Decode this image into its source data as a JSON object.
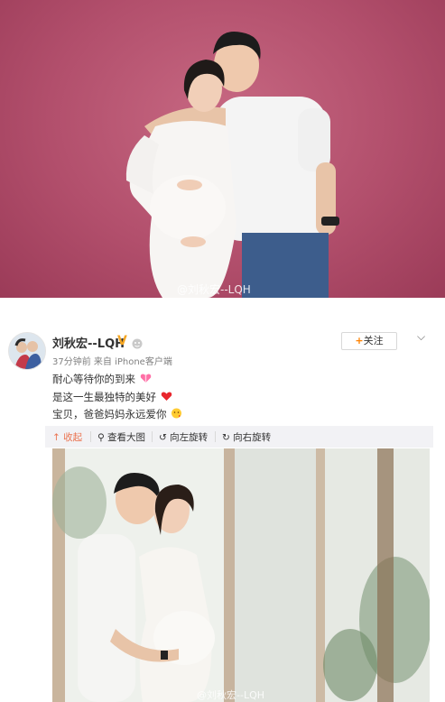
{
  "top_photo": {
    "watermark": "@刘秋宏--LQH"
  },
  "post": {
    "username": "刘秋宏--LQH",
    "verified_badge": "V",
    "meta": "37分钟前 来自 iPhone客户端",
    "follow_label": "关注",
    "follow_plus": "+",
    "lines": [
      "耐心等待你的到来",
      "是这一生最独特的美好",
      "宝贝，爸爸妈妈永远爱你"
    ],
    "emojis": [
      "heart-gift-icon",
      "red-heart-icon",
      "kiss-face-icon"
    ]
  },
  "toolbar": {
    "collapse": "收起",
    "view_large": "查看大图",
    "rotate_left": "向左旋转",
    "rotate_right": "向右旋转"
  },
  "bottom_photo": {
    "watermark": "@刘秋宏--LQH"
  },
  "colors": {
    "top_background": "#b24f6c",
    "accent_orange": "#ff8200",
    "collapse_color": "#eb7350",
    "toolbar_bg": "#f2f2f5"
  }
}
